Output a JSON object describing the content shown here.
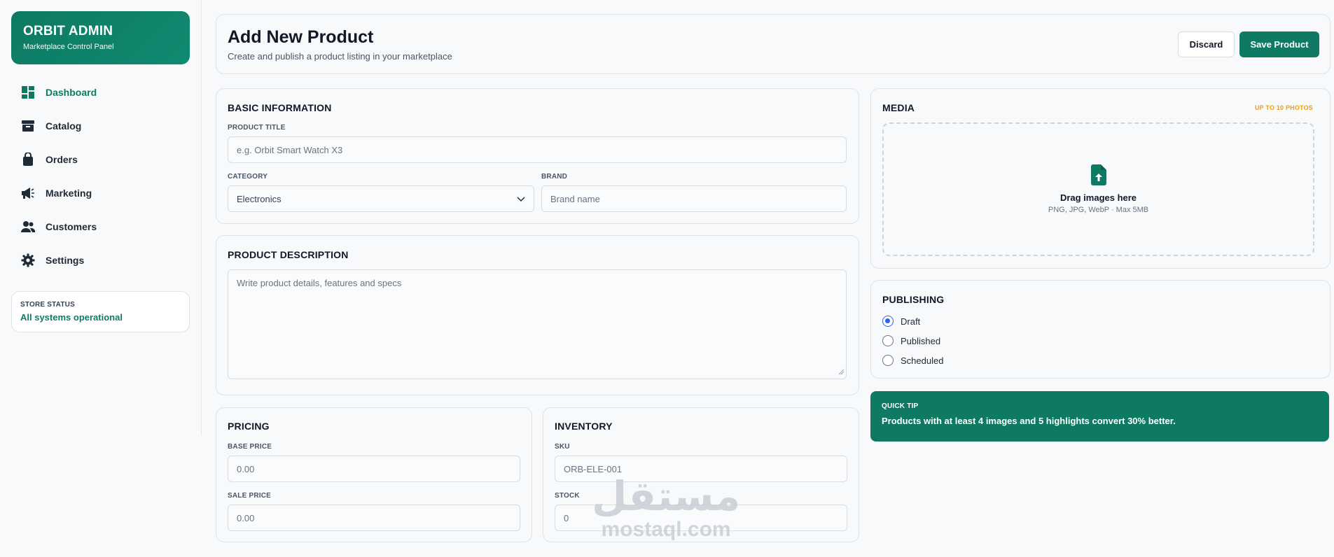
{
  "brand": {
    "title": "ORBIT ADMIN",
    "subtitle": "Marketplace Control Panel"
  },
  "sidebar": {
    "items": [
      {
        "label": "Dashboard",
        "icon": "dashboard-icon",
        "active": true
      },
      {
        "label": "Catalog",
        "icon": "archive-box-icon"
      },
      {
        "label": "Orders",
        "icon": "shopping-bag-icon"
      },
      {
        "label": "Marketing",
        "icon": "megaphone-icon"
      },
      {
        "label": "Customers",
        "icon": "users-icon"
      },
      {
        "label": "Settings",
        "icon": "gear-icon"
      }
    ],
    "status": {
      "label": "STORE STATUS",
      "value": "All systems operational"
    }
  },
  "header": {
    "title": "Add New Product",
    "subtitle": "Create and publish a product listing in your marketplace",
    "discard_label": "Discard",
    "save_label": "Save Product"
  },
  "basic": {
    "title": "BASIC INFORMATION",
    "product_title_label": "PRODUCT TITLE",
    "product_title_placeholder": "e.g. Orbit Smart Watch X3",
    "category_label": "CATEGORY",
    "category_value": "Electronics",
    "brand_label": "BRAND",
    "brand_placeholder": "Brand name"
  },
  "description": {
    "title": "PRODUCT DESCRIPTION",
    "placeholder": "Write product details, features and specs"
  },
  "pricing": {
    "title": "PRICING",
    "base_label": "BASE PRICE",
    "base_placeholder": "0.00",
    "sale_label": "SALE PRICE",
    "sale_placeholder": "0.00"
  },
  "inventory": {
    "title": "INVENTORY",
    "sku_label": "SKU",
    "sku_placeholder": "ORB-ELE-001",
    "stock_label": "STOCK",
    "stock_placeholder": "0"
  },
  "media": {
    "title": "MEDIA",
    "limit": "UP TO 10 PHOTOS",
    "drop_title": "Drag images here",
    "drop_sub": "PNG, JPG, WebP · Max 5MB"
  },
  "publishing": {
    "title": "PUBLISHING",
    "options": [
      {
        "label": "Draft",
        "checked": true
      },
      {
        "label": "Published",
        "checked": false
      },
      {
        "label": "Scheduled",
        "checked": false
      }
    ]
  },
  "tip": {
    "label": "QUICK TIP",
    "text": "Products with at least 4 images and 5 highlights convert 30% better."
  },
  "watermark": {
    "arabic": "مستقل",
    "latin": "mostaql.com"
  },
  "colors": {
    "accent": "#0e7a63",
    "radio": "#2563eb",
    "warning": "#f59e0b"
  }
}
